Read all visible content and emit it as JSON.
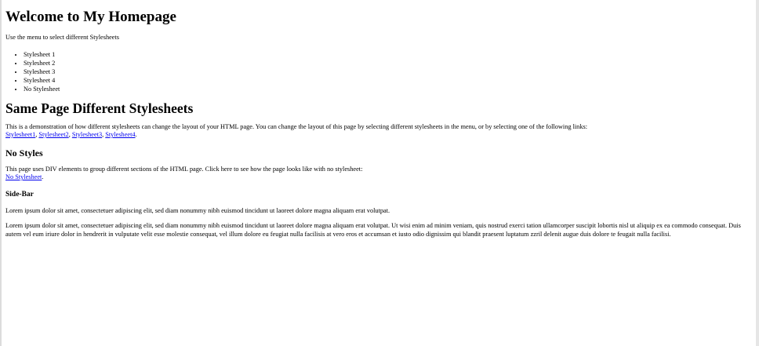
{
  "header": {
    "title": "Welcome to My Homepage",
    "intro": "Use the menu to select different Stylesheets"
  },
  "menu": {
    "items": [
      {
        "label": "Stylesheet 1"
      },
      {
        "label": "Stylesheet 2"
      },
      {
        "label": "Stylesheet 3"
      },
      {
        "label": "Stylesheet 4"
      },
      {
        "label": "No Stylesheet"
      }
    ]
  },
  "main": {
    "heading": "Same Page Different Stylesheets",
    "text": "This is a demonstration of how different stylesheets can change the layout of your HTML page. You can change the layout of this page by selecting different stylesheets in the menu, or by selecting one of the following links:",
    "links": [
      {
        "label": "Stylesheet1"
      },
      {
        "label": "Stylesheet2"
      },
      {
        "label": "Stylesheet3"
      },
      {
        "label": "Stylesheet4"
      }
    ],
    "separator": ", ",
    "end": "."
  },
  "nostyles": {
    "heading": "No Styles",
    "text": "This page uses DIV elements to group different sections of the HTML page. Click here to see how the page looks like with no stylesheet:",
    "link": "No Stylesheet",
    "end": "."
  },
  "sidebar": {
    "heading": "Side-Bar",
    "text": "Lorem ipsum dolor sit amet, consectetuer adipiscing elit, sed diam nonummy nibh euismod tincidunt ut laoreet dolore magna aliquam erat volutpat."
  },
  "footer": {
    "text": "Lorem ipsum dolor sit amet, consectetuer adipiscing elit, sed diam nonummy nibh euismod tincidunt ut laoreet dolore magna aliquam erat volutpat. Ut wisi enim ad minim veniam, quis nostrud exerci tation ullamcorper suscipit lobortis nisl ut aliquip ex ea commodo consequat. Duis autem vel eum iriure dolor in hendrerit in vulputate velit esse molestie consequat, vel illum dolore eu feugiat nulla facilisis at vero eros et accumsan et iusto odio dignissim qui blandit praesent luptatum zzril delenit augue duis dolore te feugait nulla facilisi."
  },
  "colors": {
    "link": "#0000ee",
    "text": "#000000",
    "background": "#ffffff"
  }
}
